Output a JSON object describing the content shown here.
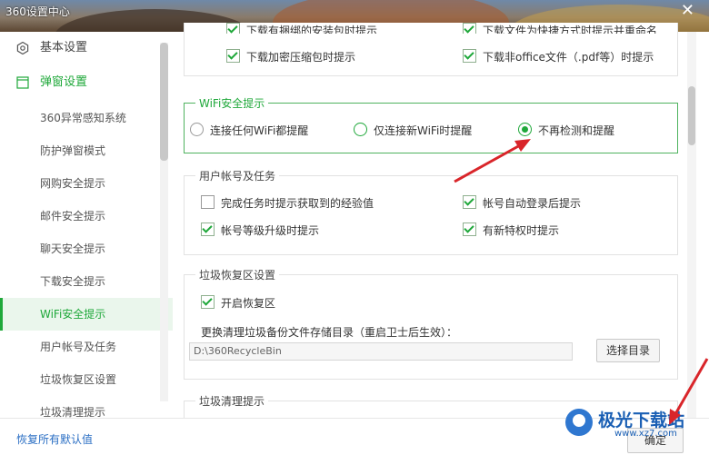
{
  "window": {
    "title": "360设置中心"
  },
  "sidebar": {
    "items": [
      {
        "label": "基本设置",
        "type": "top"
      },
      {
        "label": "弹窗设置",
        "type": "top-active"
      },
      {
        "label": "360异常感知系统",
        "type": "sub"
      },
      {
        "label": "防护弹窗模式",
        "type": "sub"
      },
      {
        "label": "网购安全提示",
        "type": "sub"
      },
      {
        "label": "邮件安全提示",
        "type": "sub"
      },
      {
        "label": "聊天安全提示",
        "type": "sub"
      },
      {
        "label": "下载安全提示",
        "type": "sub"
      },
      {
        "label": "WiFi安全提示",
        "type": "sub-active"
      },
      {
        "label": "用户帐号及任务",
        "type": "sub"
      },
      {
        "label": "垃圾恢复区设置",
        "type": "sub"
      },
      {
        "label": "垃圾清理提示",
        "type": "sub"
      }
    ]
  },
  "download_section": {
    "items": [
      {
        "label": "下载有捆绑的安装包时提示",
        "checked": true
      },
      {
        "label": "下载文件为快捷方式时提示并重命名",
        "checked": true
      },
      {
        "label": "下载加密压缩包时提示",
        "checked": true
      },
      {
        "label": "下载非office文件（.pdf等）时提示",
        "checked": true
      }
    ]
  },
  "wifi_section": {
    "title": "WiFi安全提示",
    "options": [
      {
        "label": "连接任何WiFi都提醒",
        "selected": false
      },
      {
        "label": "仅连接新WiFi时提醒",
        "selected": false
      },
      {
        "label": "不再检测和提醒",
        "selected": true
      }
    ]
  },
  "account_section": {
    "title": "用户帐号及任务",
    "items": [
      {
        "label": "完成任务时提示获取到的经验值",
        "checked": false
      },
      {
        "label": "帐号自动登录后提示",
        "checked": true
      },
      {
        "label": "帐号等级升级时提示",
        "checked": true
      },
      {
        "label": "有新特权时提示",
        "checked": true
      }
    ]
  },
  "recycle_section": {
    "title": "垃圾恢复区设置",
    "enable_label": "开启恢复区",
    "enable_checked": true,
    "dir_label": "更换清理垃圾备份文件存储目录（重启卫士后生效）：",
    "dir_value": "D:\\360RecycleBin",
    "choose_button": "选择目录"
  },
  "cleanup_section": {
    "title": "垃圾清理提示"
  },
  "footer": {
    "restore_label": "恢复所有默认值",
    "ok_label": "确定"
  },
  "watermark": {
    "text": "极光下载站",
    "url": "www.xz7.com"
  },
  "colors": {
    "accent": "#1fa83a",
    "link": "#2b6fc4",
    "annotation": "#d9252a"
  }
}
